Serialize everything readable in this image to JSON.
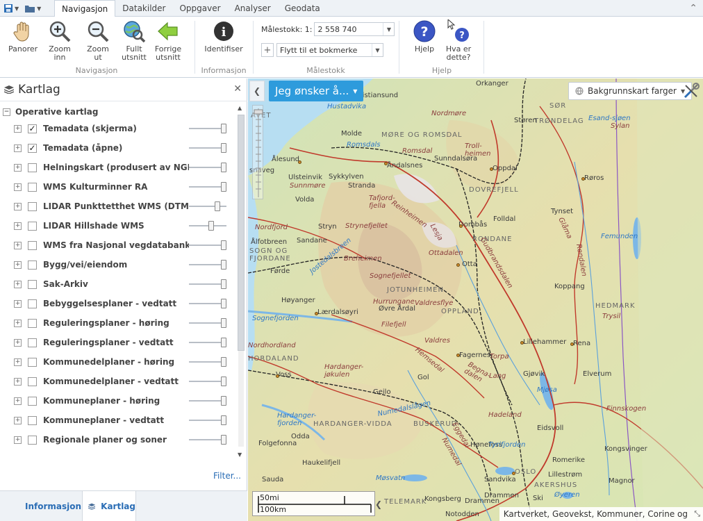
{
  "ribbon": {
    "tabs": [
      "Navigasjon",
      "Datakilder",
      "Oppgaver",
      "Analyser",
      "Geodata"
    ],
    "active_tab": "Navigasjon",
    "groups": {
      "navigasjon": {
        "label": "Navigasjon",
        "buttons": [
          {
            "label": "Panorer",
            "icon": "hand-icon"
          },
          {
            "label": "Zoom inn",
            "icon": "zoom-in-icon"
          },
          {
            "label": "Zoom ut",
            "icon": "zoom-out-icon"
          },
          {
            "label": "Fullt utsnitt",
            "icon": "globe-magnifier-icon"
          },
          {
            "label": "Forrige utsnitt",
            "icon": "green-arrow-left-icon"
          }
        ]
      },
      "informasjon": {
        "label": "Informasjon",
        "identify_label": "Identifiser"
      },
      "malestokk": {
        "label": "Målestokk",
        "scale_label": "Målestokk: 1:",
        "scale_value": "2 558 740",
        "bookmark_placeholder": "Flytt til et bokmerke"
      },
      "hjelp": {
        "label": "Hjelp",
        "help_label": "Hjelp",
        "whatis_label": "Hva er dette?"
      }
    }
  },
  "panel": {
    "title": "Kartlag",
    "root_label": "Operative kartlag",
    "layers": [
      {
        "name": "Temadata (skjerma)",
        "checked": true,
        "opacity": 1.0
      },
      {
        "name": "Temadata (åpne)",
        "checked": true,
        "opacity": 1.0
      },
      {
        "name": "Helningskart (produsert av NGI)",
        "checked": false,
        "opacity": 1.0
      },
      {
        "name": "WMS Kulturminner RA",
        "checked": false,
        "opacity": 1.0
      },
      {
        "name": "LIDAR Punkttetthet WMS (DTM)",
        "checked": false,
        "opacity": 0.8
      },
      {
        "name": "LIDAR Hillshade WMS",
        "checked": false,
        "opacity": 0.6
      },
      {
        "name": "WMS fra Nasjonal vegdatabank",
        "checked": false,
        "opacity": 1.0
      },
      {
        "name": "Bygg/vei/eiendom",
        "checked": false,
        "opacity": 1.0
      },
      {
        "name": "Sak-Arkiv",
        "checked": false,
        "opacity": 1.0
      },
      {
        "name": "Bebyggelsesplaner - vedtatt",
        "checked": false,
        "opacity": 1.0
      },
      {
        "name": "Reguleringsplaner - høring",
        "checked": false,
        "opacity": 1.0
      },
      {
        "name": "Reguleringsplaner - vedtatt",
        "checked": false,
        "opacity": 1.0
      },
      {
        "name": "Kommunedelplaner - høring",
        "checked": false,
        "opacity": 1.0
      },
      {
        "name": "Kommunedelplaner - vedtatt",
        "checked": false,
        "opacity": 1.0
      },
      {
        "name": "Kommuneplaner - høring",
        "checked": false,
        "opacity": 1.0
      },
      {
        "name": "Kommuneplaner - vedtatt",
        "checked": false,
        "opacity": 1.0
      },
      {
        "name": "Regionale planer og soner",
        "checked": false,
        "opacity": 1.0
      }
    ],
    "filter_link": "Filter...",
    "bottom_tabs": {
      "info": "Informasjon",
      "layers": "Kartlag"
    }
  },
  "map": {
    "want_button": "Jeg ønsker å...",
    "basemap_label": "Bakgrunnskart farger",
    "scalebar": {
      "top": "50mi",
      "bottom": "100km"
    },
    "attribution": "Kartverket, Geovekst, Kommuner, Corine og",
    "places": {
      "orkanger": "Orkanger",
      "kristiansund": "Kristiansund",
      "hustadvika": "Hustadvika",
      "nordmore": "Nordmøre",
      "sor": "SØR",
      "trondelag": "TRØNDELAG",
      "more_romsdal": "MØRE OG ROMSDAL",
      "molde": "Molde",
      "romsdals": "Romsdals",
      "romsdal": "Romsdal",
      "trollheimen": "Troll-heimen",
      "storen": "Støren",
      "esand": "Esand-sjøen",
      "sylan": "Sylan",
      "alesund": "Ålesund",
      "andalsnes": "Åndalsnes",
      "sunndalsora": "Sunndalsøra",
      "oppdal": "Oppdal",
      "roros": "Røros",
      "ulsteinvik": "Ulsteinvik",
      "sykkylven": "Sykkylven",
      "stranda": "Stranda",
      "sunnmore": "Sunnmøre",
      "volda": "Volda",
      "tafjord": "Tafjord-fjella",
      "reinheimen": "Reinheimen",
      "dovrefjell": "DOVREFJELL",
      "tynset": "Tynset",
      "nordfjord": "Nordfjord",
      "stryn": "Stryn",
      "strynefjellet": "Strynefjellet",
      "folldal": "Folldal",
      "dombas": "Dombås",
      "lesja": "Lesja",
      "glama": "Glåma",
      "femunden": "Femunden",
      "alfotbreen": "Ålfotbreen",
      "sandane": "Sandane",
      "sogn": "SOGN OG FJORDANE",
      "rondane": "RONDANE",
      "breheimen": "Breheimen",
      "otta": "Otta",
      "ottadalen": "Ottadalen",
      "forde": "Førde",
      "jostedalsbreen": "Jostedalsbreen",
      "sognefjellet": "Sognefjellet",
      "jotunheimen": "JOTUNHEIMEN",
      "koppang": "Koppang",
      "rendalen": "Rendalen",
      "hoyanger": "Høyanger",
      "hurrungane": "Hurrungane",
      "ovre_ardal": "Øvre Årdal",
      "valdresflye": "Valdresflye",
      "oppland": "OPPLAND",
      "hedmark": "HEDMARK",
      "trysil": "Trysil",
      "sognefjorden": "Sognefjorden",
      "laerdal": "Lærdalsøyri",
      "filefjell": "Filefjell",
      "valdres": "Valdres",
      "nordhordland": "Nordhordland",
      "fagernes": "Fagernes",
      "torpa": "Torpa",
      "lillehammer": "Lillehammer",
      "rena": "Rena",
      "hordaland": "HORDALAND",
      "voss": "Voss",
      "hemsedal": "Hemsedal",
      "gol": "Gol",
      "lang": "Lang",
      "gjovik": "Gjøvik",
      "elverum": "Elverum",
      "hallingdal": "Hallingdal",
      "hardangerjokulen": "Hardanger-jøkulen",
      "geilo": "Geilo",
      "mjosa": "Mjøsa",
      "numedalslagen": "Numedalslågen",
      "hardangerfjorden": "Hardanger-fjorden",
      "hardangervidda": "HARDANGER-VIDDA",
      "buskerud": "BUSKERUD",
      "hadeland": "Hadeland",
      "eidsvoll": "Eidsvoll",
      "finnskogen": "Finnskogen",
      "odda": "Odda",
      "folgefonna": "Folgefonna",
      "kongsvinger": "Kongsvinger",
      "honefoss": "Hønefoss",
      "tyrifjorden": "Tyrifjorden",
      "romerike": "Romerike",
      "haukelifjell": "Haukelifjell",
      "movatn": "Møsvatn",
      "sandvika": "Sandvika",
      "oslo": "OSLO",
      "lillestrom": "Lillestrøm",
      "akershus": "AKERSHUS",
      "magnor": "Magnor",
      "sauda": "Sauda",
      "kongsberg": "Kongsberg",
      "drammen": "Drammen",
      "ski": "Ski",
      "oyeren": "Øyeren",
      "telemark": "TELEMARK",
      "notodden": "Notodden",
      "kvavet": "AVET",
      "snaveg": "snaveg",
      "numedal": "Numedal",
      "eggedal": "Eggedal",
      "begnadalen": "Begna-dalen",
      "gausdal": "Gudbrandsdalen"
    }
  },
  "colors": {
    "accent": "#2e9bdc",
    "link": "#2a6db5",
    "ribbon_bg": "#eef2f6",
    "sea": "#b7def2",
    "roads": "#c0392b",
    "borders": "#222222"
  }
}
